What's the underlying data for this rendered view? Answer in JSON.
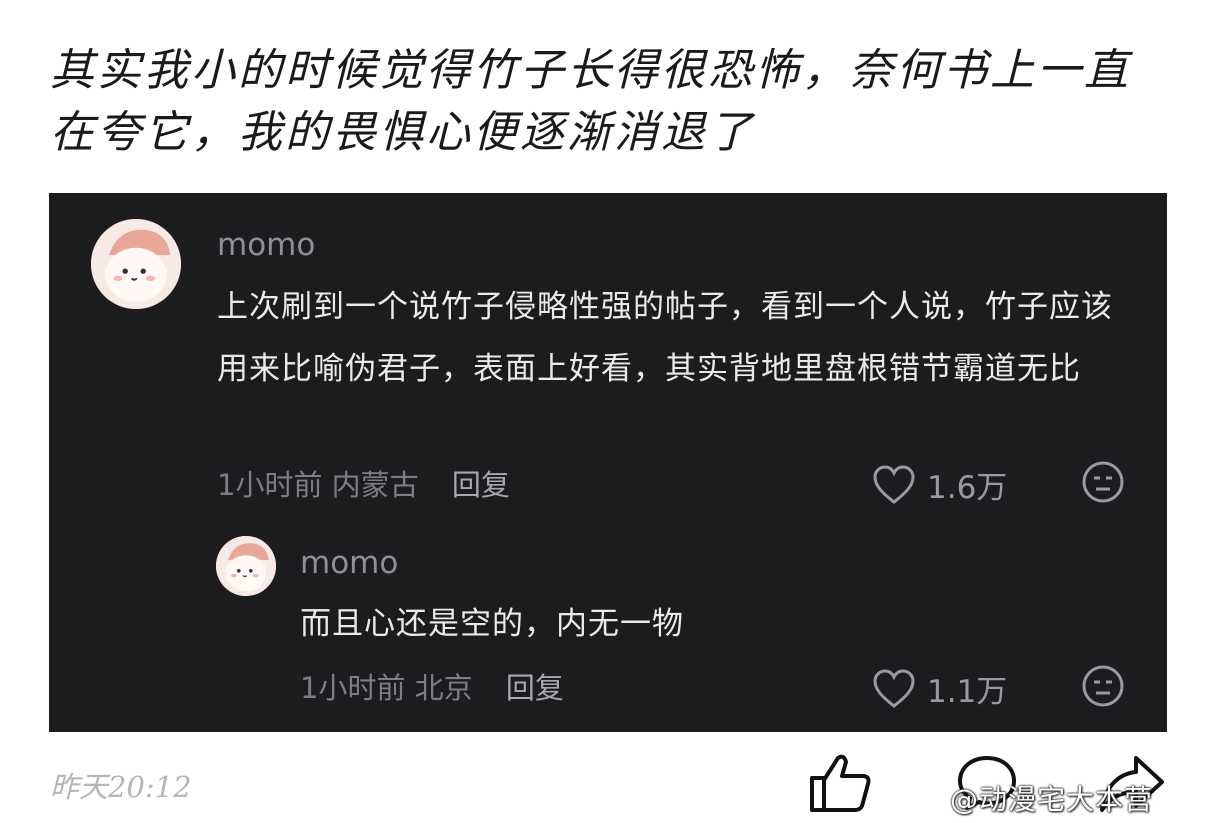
{
  "post": {
    "text": "其实我小的时候觉得竹子长得很恐怖，奈何书上一直在夸它，我的畏惧心便逐渐消退了",
    "timestamp": "昨天20:12"
  },
  "comments": [
    {
      "username": "momo",
      "text": "上次刷到一个说竹子侵略性强的帖子，看到一个人说，竹子应该用来比喻伪君子，表面上好看，其实背地里盘根错节霸道无比",
      "time": "1小时前",
      "location": "内蒙古",
      "reply_label": "回复",
      "likes": "1.6万"
    },
    {
      "username": "momo",
      "text": "而且心还是空的，内无一物",
      "time": "1小时前",
      "location": "北京",
      "reply_label": "回复",
      "likes": "1.1万"
    }
  ],
  "icons": {
    "like": "heart-icon",
    "dislike": "meh-face-icon",
    "post_like": "thumbs-up-icon",
    "post_comment": "comment-bubble-icon",
    "post_share": "share-arrow-icon"
  },
  "watermark": "@动漫宅大本营",
  "colors": {
    "card_bg": "#1c1c1f",
    "text_light": "#eaeaea",
    "meta_gray": "#7d7d82"
  }
}
